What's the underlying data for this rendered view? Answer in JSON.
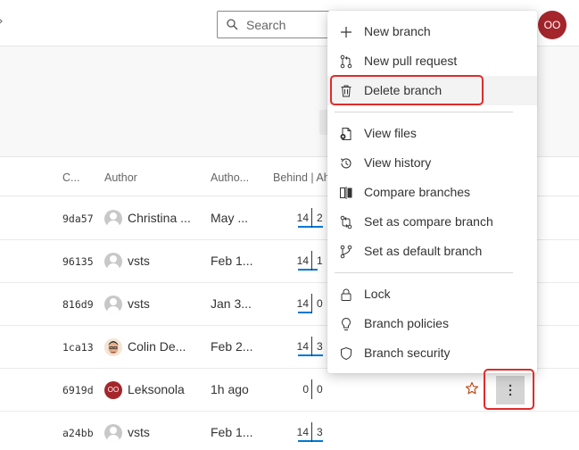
{
  "header": {
    "search_placeholder": "Search",
    "user_initials": "OO"
  },
  "table": {
    "columns": {
      "commit": "C...",
      "author": "Author",
      "authored_date": "Autho...",
      "behind_ahead": "Behind | Ah"
    },
    "rows": [
      {
        "commit": "9da57",
        "author": "Christina ...",
        "avatar": "generic",
        "date": "May ...",
        "behind": "14",
        "ahead": "2"
      },
      {
        "commit": "96135",
        "author": "vsts",
        "avatar": "generic",
        "date": "Feb 1...",
        "behind": "14",
        "ahead": "1"
      },
      {
        "commit": "816d9",
        "author": "vsts",
        "avatar": "generic",
        "date": "Jan 3...",
        "behind": "14",
        "ahead": "0"
      },
      {
        "commit": "1ca13",
        "author": "Colin De...",
        "avatar": "photo",
        "date": "Feb 2...",
        "behind": "14",
        "ahead": "3"
      },
      {
        "commit": "6919d",
        "author": "Leksonola",
        "avatar": "initials",
        "avatar_initials": "OO",
        "date": "1h ago",
        "behind": "0",
        "ahead": "0"
      },
      {
        "commit": "a24bb",
        "author": "vsts",
        "avatar": "generic",
        "date": "Feb 1...",
        "behind": "14",
        "ahead": "3"
      }
    ]
  },
  "menu": {
    "items": [
      {
        "label": "New branch",
        "icon": "plus-icon"
      },
      {
        "label": "New pull request",
        "icon": "pull-request-icon"
      },
      {
        "label": "Delete branch",
        "icon": "trash-icon"
      },
      {
        "label": "View files",
        "icon": "view-files-icon"
      },
      {
        "label": "View history",
        "icon": "history-icon"
      },
      {
        "label": "Compare branches",
        "icon": "compare-icon"
      },
      {
        "label": "Set as compare branch",
        "icon": "set-compare-icon"
      },
      {
        "label": "Set as default branch",
        "icon": "branch-icon"
      },
      {
        "label": "Lock",
        "icon": "lock-icon"
      },
      {
        "label": "Branch policies",
        "icon": "policy-icon"
      },
      {
        "label": "Branch security",
        "icon": "shield-icon"
      }
    ]
  },
  "colors": {
    "accent": "#0078d4",
    "avatar": "#a4262c",
    "highlight": "#e02b2b"
  }
}
